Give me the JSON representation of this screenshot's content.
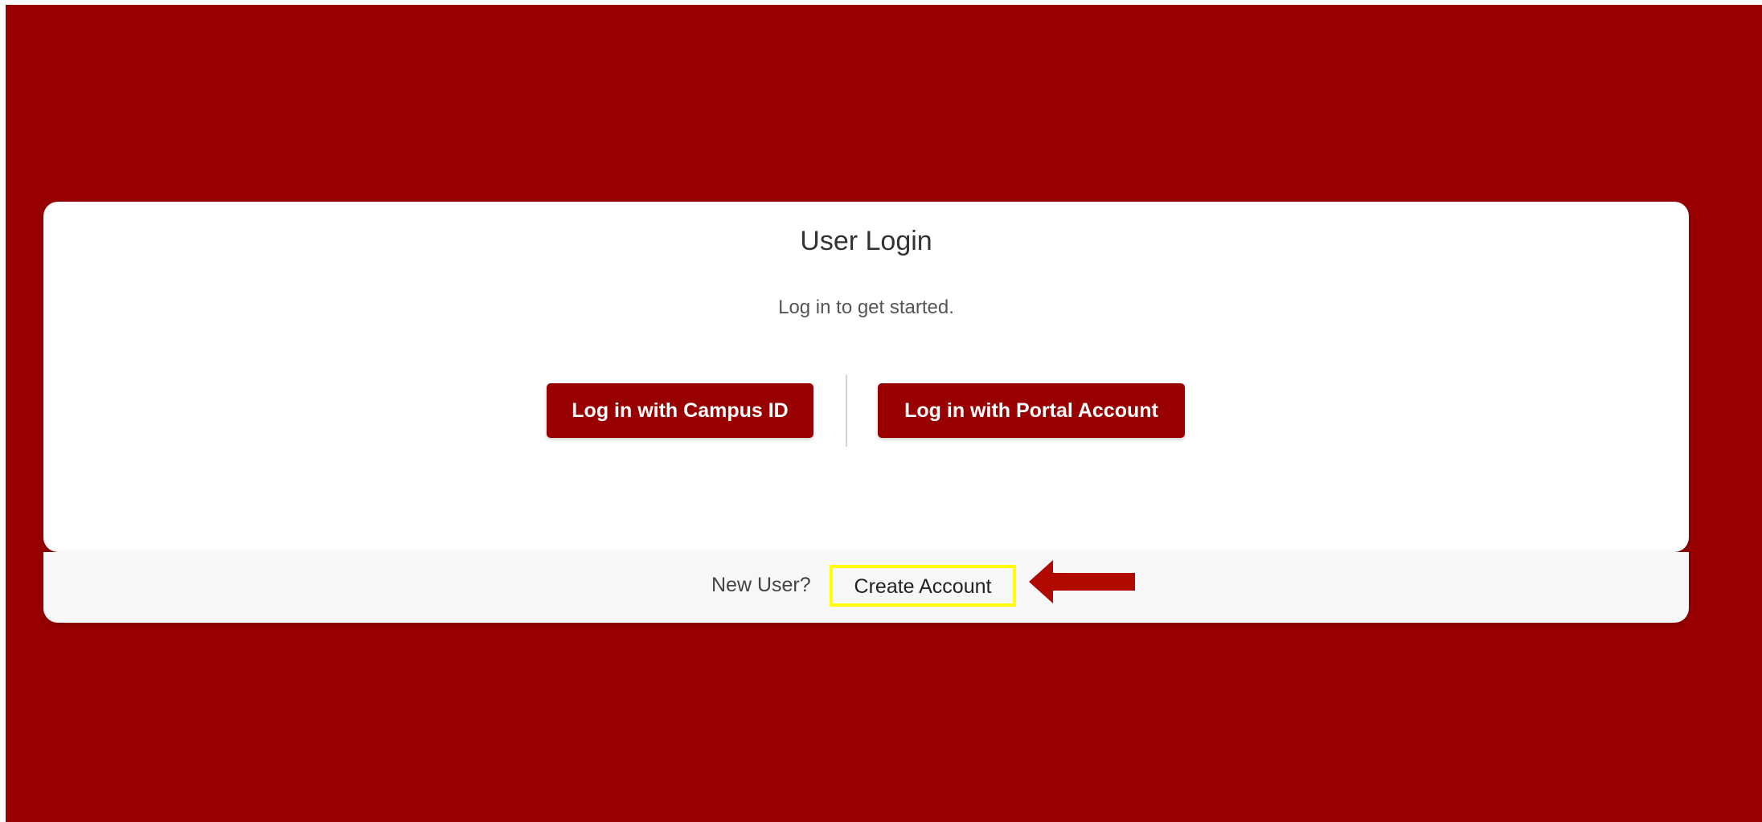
{
  "colors": {
    "brand": "#990000",
    "card_background": "#ffffff",
    "footer_background": "#f7f7f7",
    "highlight_box": "#ffff00",
    "arrow": "#b00a00"
  },
  "login_card": {
    "title": "User Login",
    "subtitle": "Log in to get started.",
    "buttons": {
      "campus_id": "Log in with Campus ID",
      "portal_account": "Log in with Portal Account"
    }
  },
  "footer": {
    "new_user_label": "New User?",
    "create_account_link": "Create Account"
  },
  "annotation": {
    "icon": "left-arrow-icon"
  }
}
